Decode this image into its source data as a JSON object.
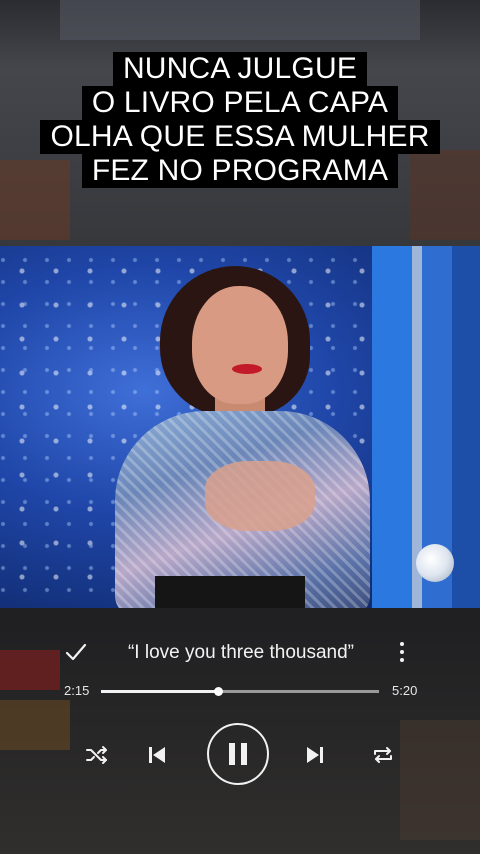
{
  "caption": {
    "lines": [
      "NUNCA JULGUE",
      "O LIVRO PELA CAPA",
      "OLHA QUE ESSA MULHER",
      "FEZ NO PROGRAMA"
    ]
  },
  "player": {
    "song_title": "“I love you three thousand”",
    "elapsed": "2:15",
    "total": "5:20",
    "progress_fraction": 0.4219,
    "icons": {
      "check": "check-icon",
      "more": "more-vertical-icon",
      "shuffle": "shuffle-icon",
      "previous": "skip-previous-icon",
      "pause": "pause-icon",
      "next": "skip-next-icon",
      "repeat": "repeat-icon"
    }
  },
  "colors": {
    "caption_bg": "#000000",
    "caption_text": "#ffffff",
    "player_text": "#f2f2f2",
    "stage_blue": "#1f46a8"
  }
}
